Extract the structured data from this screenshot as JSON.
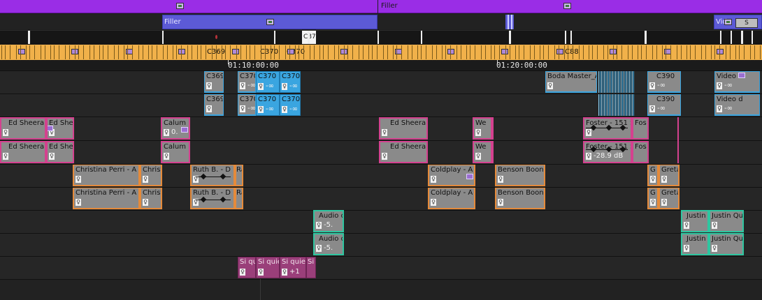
{
  "colors": {
    "video_clip": "#8a8a8a",
    "video_border": "#3aa5e0",
    "audio_pink": "#d4418f",
    "audio_orange": "#e58a3a",
    "audio_teal": "#2ec6a0",
    "audio_plum": "#9a3f7a",
    "filler_banner": "#9a2de6",
    "filler_blue": "#5c5ad6",
    "sequence_gold": "#f1b14a"
  },
  "banners": [
    {
      "label": ""
    },
    {
      "label": "Filler"
    }
  ],
  "filler_bar": {
    "label": "Filler",
    "right_label": "Vide",
    "right_tag": "S"
  },
  "marker_row": {
    "label": "C87"
  },
  "sequence_row": {
    "labels": [
      "C369",
      "C370",
      "C370",
      "C88"
    ]
  },
  "timecodes": [
    "01:10:00:00",
    "01:20:00:00"
  ],
  "tracks": {
    "v1": [
      {
        "name": "C369",
        "gain": ""
      },
      {
        "name": "C370",
        "gain": "-∞"
      },
      {
        "name": "C370",
        "gain": "-∞"
      },
      {
        "name": "C370",
        "gain": "-∞"
      },
      {
        "name": "Boda Master_A",
        "gain": ""
      },
      {
        "name": "C390",
        "gain": "-∞"
      },
      {
        "name": "Video d",
        "gain": "-∞"
      }
    ],
    "v2": [
      {
        "name": "C369",
        "gain": ""
      },
      {
        "name": "C370",
        "gain": "-∞"
      },
      {
        "name": "C370",
        "gain": "-∞"
      },
      {
        "name": "C370",
        "gain": "-∞"
      },
      {
        "name": "C390",
        "gain": "-∞"
      },
      {
        "name": "Video d",
        "gain": "-∞"
      }
    ],
    "a1": [
      {
        "name": "Ed Sheeran",
        "gain": ""
      },
      {
        "name": "Ed Shee",
        "gain": ""
      },
      {
        "name": "Calum",
        "gain": "0."
      },
      {
        "name": "Ed Sheera",
        "gain": ""
      },
      {
        "name": "We",
        "gain": ""
      },
      {
        "name": "Foster - 151 S",
        "gain": ""
      },
      {
        "name": "Fos",
        "gain": ""
      }
    ],
    "a2": [
      {
        "name": "Ed Sheeran",
        "gain": ""
      },
      {
        "name": "Ed Shee",
        "gain": ""
      },
      {
        "name": "Calum",
        "gain": ""
      },
      {
        "name": "Ed Sheera",
        "gain": ""
      },
      {
        "name": "We",
        "gain": ""
      },
      {
        "name": "Foster - 151 S",
        "gain": "-28.9 dB"
      },
      {
        "name": "Fos",
        "gain": ""
      }
    ],
    "a3": [
      {
        "name": "Christina Perri - A T",
        "gain": ""
      },
      {
        "name": "Christ",
        "gain": ""
      },
      {
        "name": "Ruth B. - D",
        "gain": ""
      },
      {
        "name": "Ra",
        "gain": ""
      },
      {
        "name": "Coldplay - A",
        "gain": ""
      },
      {
        "name": "Benson Boone",
        "gain": ""
      },
      {
        "name": "G",
        "gain": ""
      },
      {
        "name": "Greta",
        "gain": ""
      }
    ],
    "a4": [
      {
        "name": "Christina Perri - A T",
        "gain": ""
      },
      {
        "name": "Christ",
        "gain": ""
      },
      {
        "name": "Ruth B. - D",
        "gain": ""
      },
      {
        "name": "Ra",
        "gain": ""
      },
      {
        "name": "Coldplay - A",
        "gain": ""
      },
      {
        "name": "Benson Boone",
        "gain": ""
      },
      {
        "name": "G",
        "gain": ""
      },
      {
        "name": "Greta",
        "gain": ""
      }
    ],
    "a5": [
      {
        "name": "Audio d",
        "gain": "-5."
      },
      {
        "name": "Justin",
        "gain": ""
      },
      {
        "name": "Justin Qu",
        "gain": ""
      }
    ],
    "a6": [
      {
        "name": "Audio d",
        "gain": "-5."
      },
      {
        "name": "Justin",
        "gain": ""
      },
      {
        "name": "Justin Qu",
        "gain": ""
      }
    ],
    "a7": [
      {
        "name": "Si qui",
        "gain": ""
      },
      {
        "name": "Si quie",
        "gain": ""
      },
      {
        "name": "Si quie",
        "gain": "+1"
      },
      {
        "name": "Si",
        "gain": ""
      }
    ]
  }
}
